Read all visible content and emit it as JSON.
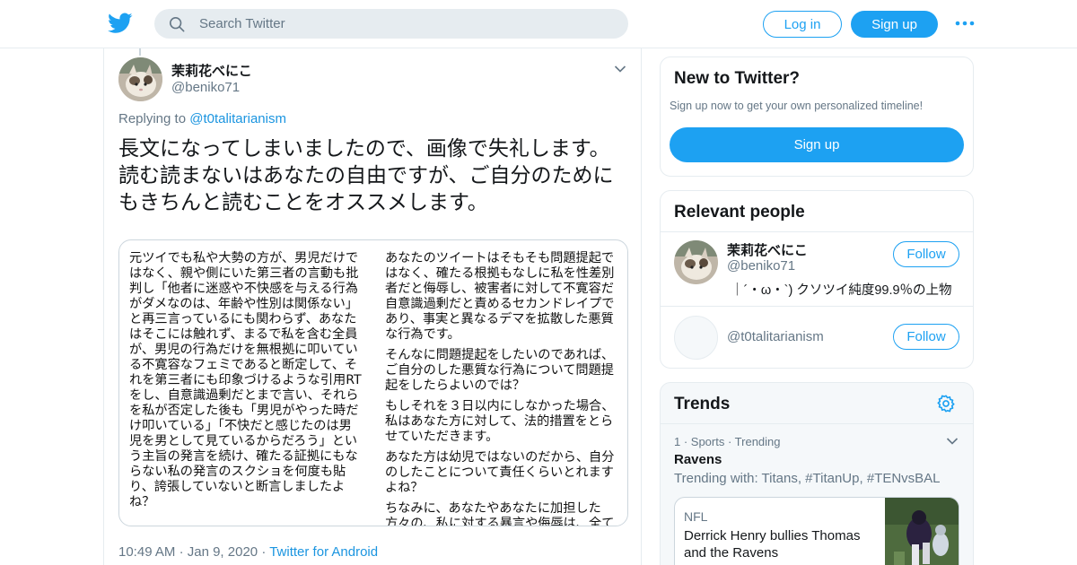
{
  "header": {
    "search_placeholder": "Search Twitter",
    "login_label": "Log in",
    "signup_label": "Sign up",
    "brand_color": "#1da1f2"
  },
  "tweet": {
    "display_name": "茉莉花べにこ",
    "handle": "@beniko71",
    "replying_prefix": "Replying to",
    "replying_to": "@t0talitarianism",
    "text": "長文になってしまいましたので、画像で失礼します。読む読まないはあなたの自由ですが、ご自分のためにもきちんと読むことをオススメします。",
    "image_text_left": [
      "元ツイでも私や大勢の方が、男児だけではなく、親や側にいた第三者の言動も批判し「他者に迷惑や不快感を与える行為がダメなのは、年齢や性別は関係ない」と再三言っているにも関わらず、あなたはそこには触れず、まるで私を含む全員が、男児の行為だけを無根拠に叩いている不寛容なフェミであると断定して、それを第三者にも印象づけるような引用RTをし、自意識過剰だとまで言い、それらを私が否定した後も「男児がやった時だけ叩いている」「不快だと感じたのは男児を男として見ているからだろう」という主旨の発言を続け、確たる証拠にもならない私の発言のスクショを何度も貼り、誇張していないと断言しましたよね？"
    ],
    "image_text_right": [
      "あなたのツイートはそもそも問題提起ではなく、確たる根拠もなしに私を性差別者だと侮辱し、被害者に対して不寛容だ自意識過剰だと責めるセカンドレイプであり、事実と異なるデマを拡散した悪質な行為です。",
      "そんなに問題提起をしたいのであれば、ご自分のした悪質な行為について問題提起をしたらよいのでは？",
      "もしそれを３日以内にしなかった場合、私はあなた方に対して、法的措置をとらせていただきます。",
      "あなた方は幼児ではないのだから、自分のしたことについて責任くらいとれますよね？",
      "ちなみに、あなたやあなたに加担した方々の、私に対する暴言や侮辱は、全て証拠としてとってありますので、もし謝"
    ],
    "time": "10:49 AM",
    "date": "Jan 9, 2020",
    "source": "Twitter for Android"
  },
  "sidebar": {
    "new": {
      "title": "New to Twitter?",
      "subtitle": "Sign up now to get your own personalized timeline!",
      "signup_label": "Sign up"
    },
    "people": {
      "title": "Relevant people",
      "items": [
        {
          "name": "茉莉花べにこ",
          "handle": "@beniko71",
          "bio": "｜´・ω・`) クソツイ純度99.9％の上物",
          "follow_label": "Follow"
        },
        {
          "name": "",
          "handle": "@t0talitarianism",
          "bio": "",
          "follow_label": "Follow"
        }
      ]
    },
    "trends": {
      "title": "Trends",
      "item": {
        "meta": "1 · Sports · Trending",
        "name": "Ravens",
        "with": "Trending with: Titans, #TitanUp, #TENvsBAL"
      },
      "news": {
        "source": "NFL",
        "title": "Derrick Henry bullies Thomas and the Ravens"
      }
    }
  }
}
